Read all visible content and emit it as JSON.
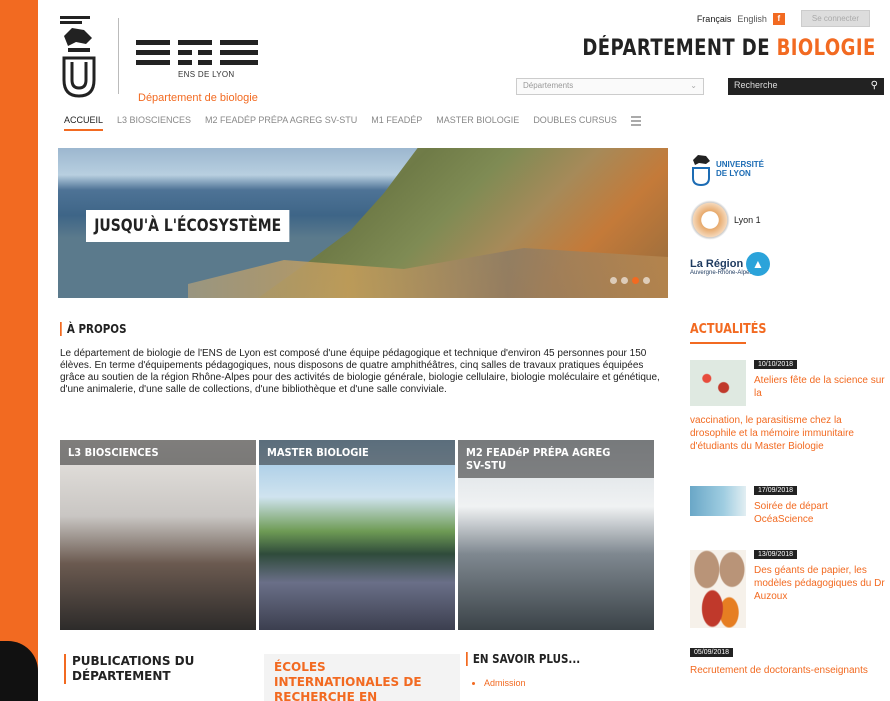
{
  "header": {
    "languages": [
      {
        "label": "Français",
        "active": true
      },
      {
        "label": "English",
        "active": false
      }
    ],
    "lang_badge": "f",
    "connect_label": "Se connecter",
    "ens_sub": "ENS DE LYON",
    "dept_link": "Département de biologie",
    "title_main": "DÉPARTEMENT DE ",
    "title_accent": "BIOLOGIE",
    "dept_select_placeholder": "Départements",
    "search_placeholder": "Recherche"
  },
  "nav": {
    "items": [
      {
        "label": "ACCUEIL",
        "active": true
      },
      {
        "label": "L3 BIOSCIENCES",
        "active": false
      },
      {
        "label": "M2 FEADéP PRÉPA AGREG SV-STU",
        "active": false
      },
      {
        "label": "M1 FEADéP",
        "active": false
      },
      {
        "label": "MASTER BIOLOGIE",
        "active": false
      },
      {
        "label": "DOUBLES CURSUS",
        "active": false
      }
    ]
  },
  "hero": {
    "caption": "JUSQU'À L'ÉCOSYSTÈME"
  },
  "partners": {
    "univ_line1": "UNIVERSITÉ",
    "univ_line2": "DE LYON",
    "lyon1": "Lyon 1",
    "region": "La Région",
    "region_sub": "Auvergne-Rhône-Alpes"
  },
  "about": {
    "title": "À PROPOS",
    "text": "Le département de biologie de l'ENS de Lyon est composé d'une équipe pédagogique et technique d'environ 45 personnes pour 150 élèves. En terme d'équipements pédagogiques, nous disposons de quatre amphithéâtres, cinq salles de travaux pratiques équipées grâce au soutien de la région Rhône-Alpes pour des activités de biologie générale, biologie cellulaire, biologie moléculaire et génétique, d'une animalerie, d'une salle de collections, d'une bibliothèque et d'une salle conviviale."
  },
  "tiles": [
    {
      "title": "L3 BIOSCIENCES"
    },
    {
      "title": "MASTER BIOLOGIE"
    },
    {
      "title": "M2 FEADéP PRÉPA AGREG SV-STU"
    }
  ],
  "bottom": {
    "pubs_title": "PUBLICATIONS DU DÉPARTEMENT",
    "ecoles_title": "ÉCOLES INTERNATIONALES DE RECHERCHE EN",
    "ensavoir_title": "EN SAVOIR PLUS...",
    "ensavoir_items": [
      "Admission"
    ]
  },
  "news": {
    "header": "ACTUALITÉS",
    "items": [
      {
        "date": "10/10/2018",
        "text": "Ateliers fête de la science sur la",
        "text_cont": "vaccination, le parasitisme chez la drosophile et la mémoire immunitaire d'étudiants du Master Biologie"
      },
      {
        "date": "17/09/2018",
        "text": "Soirée de départ OcéaScience"
      },
      {
        "date": "13/09/2018",
        "text": "Des géants de papier, les modèles pédagogiques du Dr Auzoux"
      },
      {
        "date": "05/09/2018",
        "text": "Recrutement de doctorants-enseignants"
      }
    ]
  }
}
